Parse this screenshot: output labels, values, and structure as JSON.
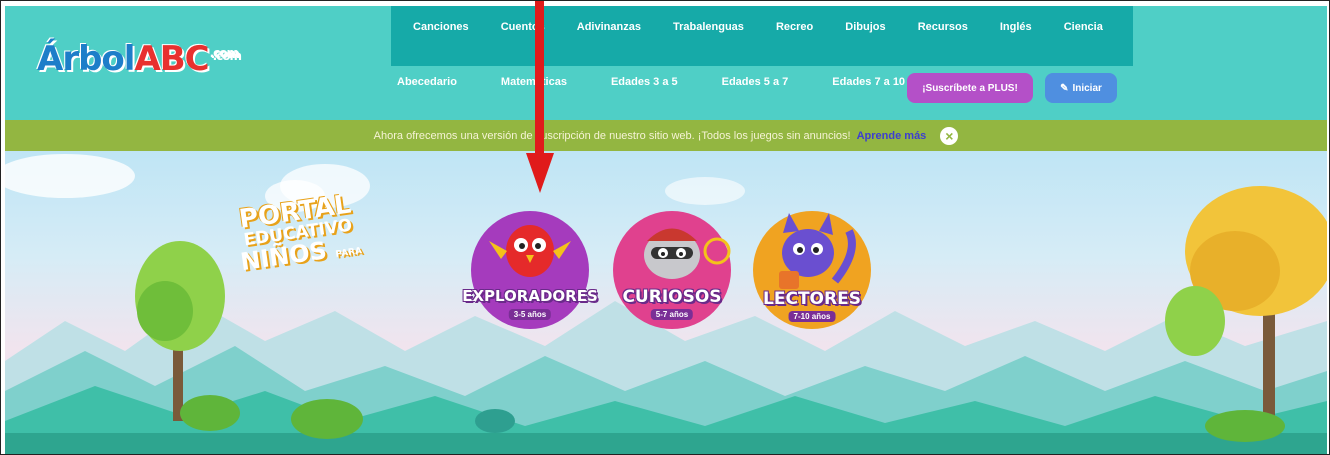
{
  "logo": {
    "text_main": "Árbol",
    "text_abc": "ABC",
    "text_com": ".com"
  },
  "nav": {
    "primary": [
      "Canciones",
      "Cuentos",
      "Adivinanzas",
      "Trabalenguas",
      "Recreo",
      "Dibujos",
      "Recursos",
      "Inglés",
      "Ciencia"
    ],
    "secondary": [
      "Abecedario",
      "Matemáticas",
      "Edades 3 a 5",
      "Edades 5 a 7",
      "Edades 7 a 10"
    ],
    "subscribe_label": "¡Suscríbete a PLUS!",
    "login_label": "Iniciar"
  },
  "notice": {
    "text": "Ahora ofrecemos una versión de suscripción de nuestro sitio web. ¡Todos los juegos sin anuncios!",
    "link_label": "Aprende más"
  },
  "hero": {
    "portal": {
      "line1": "PORTAL",
      "line2": "EDUCATIVO",
      "line3": "NIÑOS",
      "small": "PARA"
    },
    "badges": [
      {
        "label": "EXPLORADORES",
        "age": "3-5 años",
        "color": "#a53bbd"
      },
      {
        "label": "CURIOSOS",
        "age": "5-7 años",
        "color": "#e0418e"
      },
      {
        "label": "LECTORES",
        "age": "7-10 años",
        "color": "#f0a321"
      }
    ]
  },
  "colors": {
    "header": "#4fcfc6",
    "nav_box": "#16aaa8",
    "notice": "#93b641",
    "arrow": "#e01b1b"
  }
}
